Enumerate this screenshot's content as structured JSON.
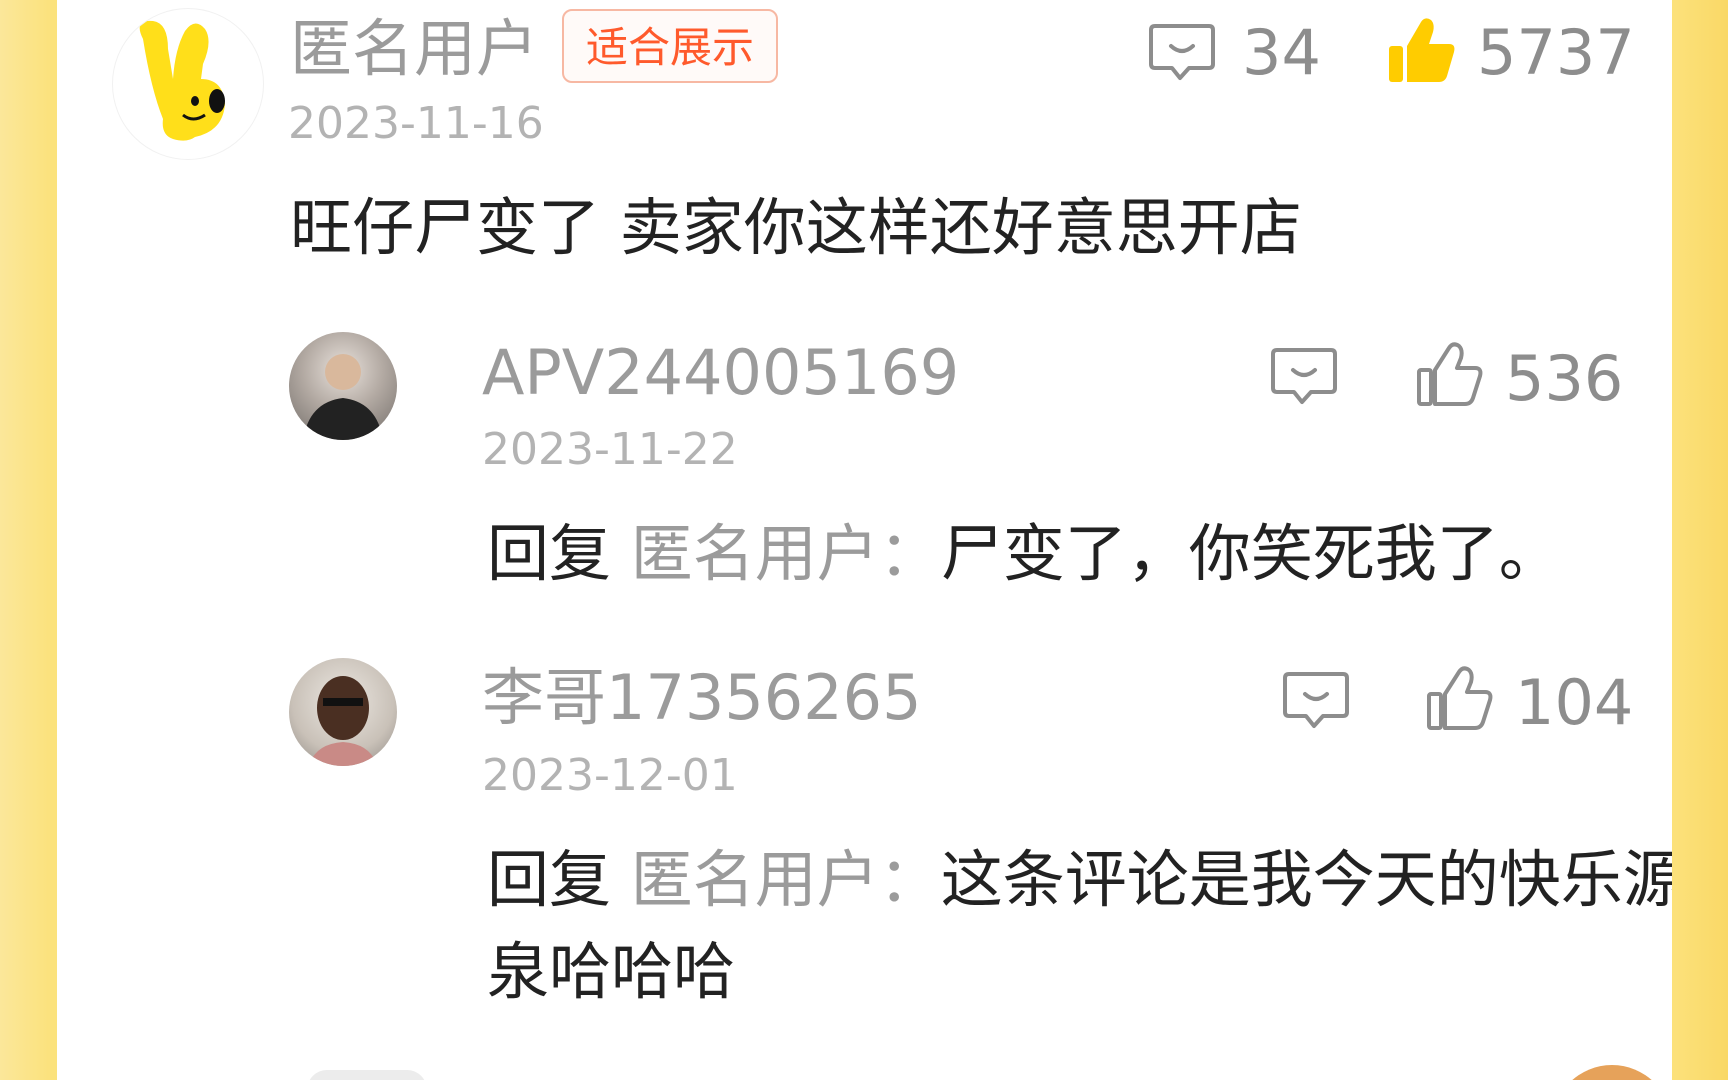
{
  "comment": {
    "username": "匿名用户",
    "tag": "适合展示",
    "date": "2023-11-16",
    "reply_count": "34",
    "like_count": "5737",
    "text": "旺仔尸变了 卖家你这样还好意思开店"
  },
  "replies": [
    {
      "username": "APV244005169",
      "date": "2023-11-22",
      "like_count": "536",
      "prefix": "回复",
      "target": "匿名用户：",
      "text": "尸变了，你笑死我了。"
    },
    {
      "username": "李哥17356265",
      "date": "2023-12-01",
      "like_count": "104",
      "prefix": "回复",
      "target": "匿名用户：",
      "text": "这条评论是我今天的快乐源泉哈哈哈"
    }
  ],
  "icons": {
    "reply": "comment-bubble-icon",
    "like_filled": "thumbs-up-filled-icon",
    "like_outline": "thumbs-up-outline-icon"
  },
  "colors": {
    "accent_tag": "#ff5a2c",
    "like_filled": "#ffcc00",
    "background": "#fce17a"
  }
}
